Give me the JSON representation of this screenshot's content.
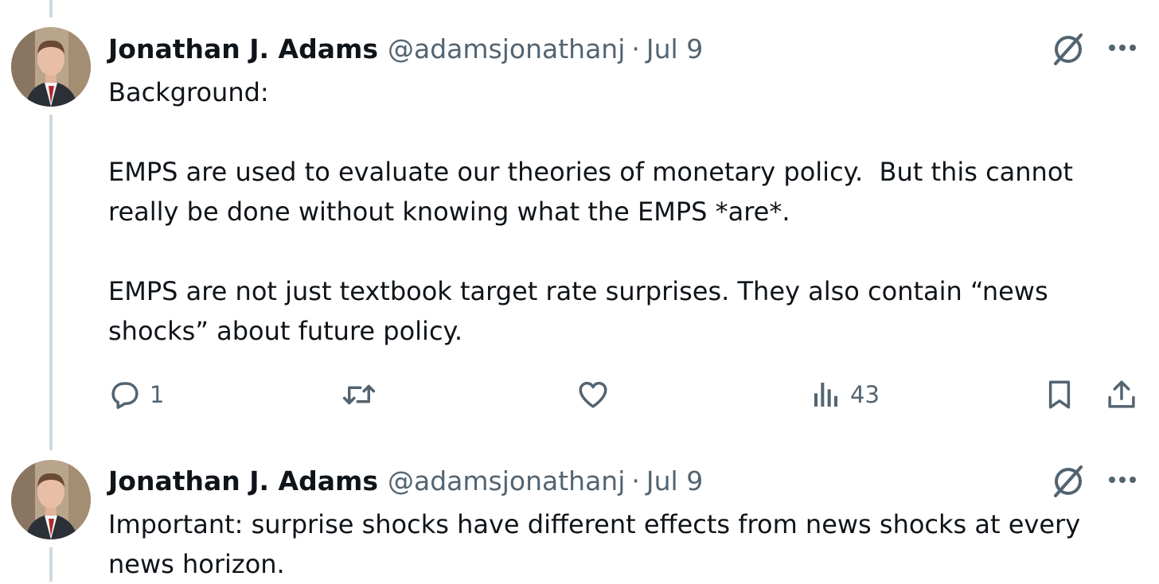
{
  "tweets": [
    {
      "author": {
        "display_name": "Jonathan J. Adams",
        "handle": "@adamsjonathanj",
        "separator": "·",
        "date": "Jul 9",
        "avatar": "profile-photo"
      },
      "text": {
        "paragraphs": [
          "Background:",
          "EMPS are used to evaluate our theories of monetary policy.  But this cannot really be done without knowing what the EMPS *are*.",
          "EMPS are not just textbook target rate surprises. They also contain “news shocks” about future policy."
        ]
      },
      "actions": {
        "reply_count": "1",
        "views_count": "43"
      }
    },
    {
      "author": {
        "display_name": "Jonathan J. Adams",
        "handle": "@adamsjonathanj",
        "separator": "·",
        "date": "Jul 9",
        "avatar": "profile-photo"
      },
      "text": {
        "paragraphs": [
          "Important: surprise shocks have different effects from news shocks at every news horizon."
        ]
      }
    }
  ],
  "icons": {
    "grok": "grok-icon",
    "more": "more-icon",
    "reply": "reply-icon",
    "retweet": "retweet-icon",
    "like": "heart-icon",
    "views": "views-icon",
    "bookmark": "bookmark-icon",
    "share": "share-icon"
  },
  "colors": {
    "text": "#0f1419",
    "secondary": "#536471",
    "thread_line": "#cfd9de",
    "background": "#ffffff"
  }
}
